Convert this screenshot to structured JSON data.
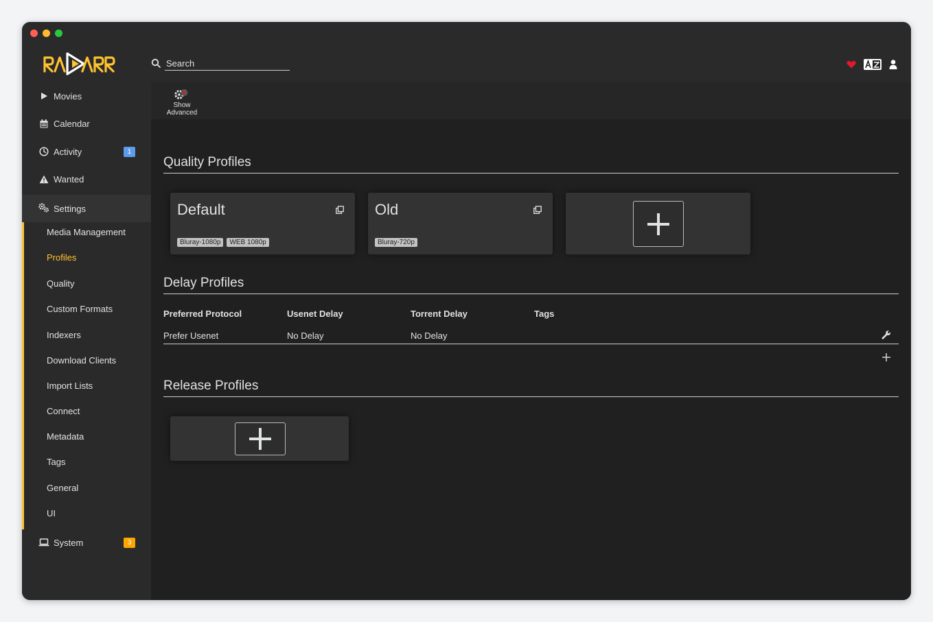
{
  "app": {
    "logo_text": "RADARR",
    "brand_color": "#ffc230"
  },
  "search": {
    "placeholder": "Search"
  },
  "header_icons": [
    "heart-icon",
    "translate-icon",
    "user-icon"
  ],
  "sidebar": {
    "items": [
      {
        "label": "Movies",
        "icon": "play-icon"
      },
      {
        "label": "Calendar",
        "icon": "calendar-icon"
      },
      {
        "label": "Activity",
        "icon": "clock-icon",
        "badge": "1",
        "badge_color": "#5d9cec"
      },
      {
        "label": "Wanted",
        "icon": "warning-icon"
      },
      {
        "label": "Settings",
        "icon": "gears-icon"
      },
      {
        "label": "System",
        "icon": "laptop-icon",
        "badge": "3",
        "badge_color": "#ffa500"
      }
    ],
    "settings_sub": [
      "Media Management",
      "Profiles",
      "Quality",
      "Custom Formats",
      "Indexers",
      "Download Clients",
      "Import Lists",
      "Connect",
      "Metadata",
      "Tags",
      "General",
      "UI"
    ],
    "active_sub": "Profiles"
  },
  "toolbar": {
    "show_advanced_line1": "Show",
    "show_advanced_line2": "Advanced"
  },
  "quality_profiles": {
    "title": "Quality Profiles",
    "profiles": [
      {
        "name": "Default",
        "tags": [
          "Bluray-1080p",
          "WEB 1080p"
        ]
      },
      {
        "name": "Old",
        "tags": [
          "Bluray-720p"
        ]
      }
    ]
  },
  "delay_profiles": {
    "title": "Delay Profiles",
    "columns": [
      "Preferred Protocol",
      "Usenet Delay",
      "Torrent Delay",
      "Tags"
    ],
    "rows": [
      {
        "protocol": "Prefer Usenet",
        "usenet_delay": "No Delay",
        "torrent_delay": "No Delay",
        "tags": ""
      }
    ]
  },
  "release_profiles": {
    "title": "Release Profiles"
  }
}
